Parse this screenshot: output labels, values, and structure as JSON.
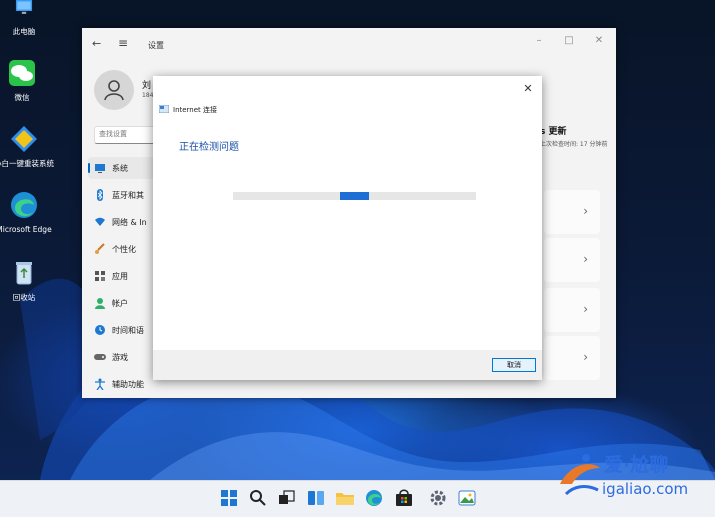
{
  "desktop": {
    "icons": [
      {
        "label": "此电脑"
      },
      {
        "label": "微信"
      },
      {
        "label": "小白一键重装系统"
      },
      {
        "label": "Microsoft Edge"
      },
      {
        "label": "回收站"
      }
    ]
  },
  "settings": {
    "title": "设置",
    "user_name": "刘",
    "user_sub": "184",
    "search_placeholder": "查找设置",
    "nav": [
      {
        "label": "系统",
        "icon": "monitor-icon",
        "active": true
      },
      {
        "label": "蓝牙和其",
        "icon": "bluetooth-icon"
      },
      {
        "label": "网络 & In",
        "icon": "wifi-icon"
      },
      {
        "label": "个性化",
        "icon": "brush-icon"
      },
      {
        "label": "应用",
        "icon": "apps-icon"
      },
      {
        "label": "帐户",
        "icon": "person-icon"
      },
      {
        "label": "时间和语",
        "icon": "globe-clock-icon"
      },
      {
        "label": "游戏",
        "icon": "gamepad-icon"
      },
      {
        "label": "辅助功能",
        "icon": "accessibility-icon"
      }
    ],
    "update_title": "s 更新",
    "update_sub": "上次检查时间: 17 分钟前",
    "cards_chevron": "›"
  },
  "dialog": {
    "title": "Internet 连接",
    "heading": "正在检测问题",
    "cancel_label": "取消",
    "progress_fraction": 0.12
  },
  "taskbar": {
    "apps": [
      "start-icon",
      "search-icon",
      "task-view-icon",
      "widgets-icon",
      "file-explorer-icon",
      "edge-icon",
      "store-icon",
      "settings-gear-icon",
      "photos-icon"
    ]
  },
  "watermark": {
    "top": "爱·尬聊",
    "bottom": "igaliao.com"
  },
  "colors": {
    "accent": "#0067c0",
    "progress": "#1d6fd6",
    "dialog_heading": "#1a4fa8"
  }
}
